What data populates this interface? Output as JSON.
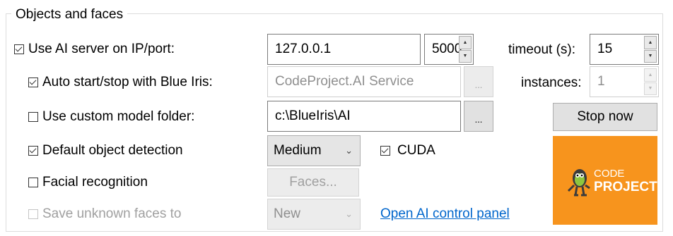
{
  "group": {
    "title": "Objects and faces"
  },
  "use_ai_server": {
    "label": "Use AI server on IP/port:",
    "checked": true,
    "ip": "127.0.0.1",
    "port": "5000"
  },
  "timeout": {
    "label": "timeout (s):",
    "value": "15"
  },
  "auto_start": {
    "label": "Auto start/stop with Blue Iris:",
    "checked": true,
    "service": "CodeProject.AI Service",
    "browse_label": "..."
  },
  "instances": {
    "label": "instances:",
    "value": "1"
  },
  "custom_model": {
    "label": "Use custom model folder:",
    "checked": false,
    "folder": "c:\\BlueIris\\AI",
    "browse_label": "..."
  },
  "stop_button": {
    "label": "Stop now"
  },
  "default_detection": {
    "label": "Default object detection",
    "checked": true,
    "selected": "Medium"
  },
  "cuda": {
    "label": "CUDA",
    "checked": true
  },
  "facial": {
    "label": "Facial recognition",
    "checked": false,
    "faces_label": "Faces..."
  },
  "save_unknown": {
    "label": "Save unknown faces to",
    "checked": false,
    "selected": "New"
  },
  "control_panel_link": {
    "label": "Open AI control panel"
  },
  "logo": {
    "line1": "CODE",
    "line2": "PROJECT",
    "background": "#f7941d"
  }
}
